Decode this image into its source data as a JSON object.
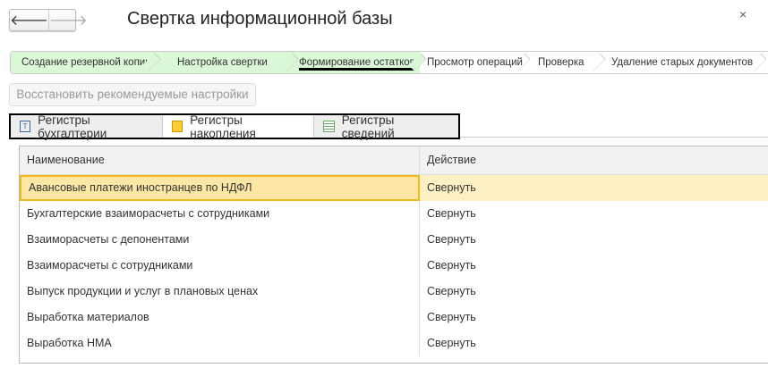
{
  "window": {
    "title": "Свертка информационной базы",
    "back": "🡐",
    "forward": "🡒",
    "close": "×"
  },
  "steps": [
    {
      "label": "Создание резервной копии",
      "state": "done"
    },
    {
      "label": "Настройка свертки",
      "state": "done"
    },
    {
      "label": "Формирование остатков",
      "state": "current"
    },
    {
      "label": "Просмотр операций",
      "state": "todo"
    },
    {
      "label": "Проверка",
      "state": "todo"
    },
    {
      "label": "Удаление старых документов",
      "state": "todo"
    }
  ],
  "restore_button": "Восстановить рекомендуемые настройки",
  "tabs": [
    {
      "label": "Регистры бухгалтерии",
      "icon": "accounting-register-icon",
      "active": false
    },
    {
      "label": "Регистры накопления",
      "icon": "accumulation-register-icon",
      "active": true
    },
    {
      "label": "Регистры сведений",
      "icon": "information-register-icon",
      "active": false
    }
  ],
  "table": {
    "columns": [
      "Наименование",
      "Действие"
    ],
    "rows": [
      [
        "Авансовые платежи иностранцев по НДФЛ",
        "Свернуть"
      ],
      [
        "Бухгалтерские взаиморасчеты с сотрудниками",
        "Свернуть"
      ],
      [
        "Взаиморасчеты с депонентами",
        "Свернуть"
      ],
      [
        "Взаиморасчеты с сотрудниками",
        "Свернуть"
      ],
      [
        "Выпуск продукции и услуг в плановых ценах",
        "Свернуть"
      ],
      [
        "Выработка материалов",
        "Свернуть"
      ],
      [
        "Выработка НМА",
        "Свернуть"
      ]
    ]
  },
  "colors": {
    "done_step": "#daf7d8",
    "selection": "#fce7a4",
    "selection_border": "#f5b81c"
  }
}
